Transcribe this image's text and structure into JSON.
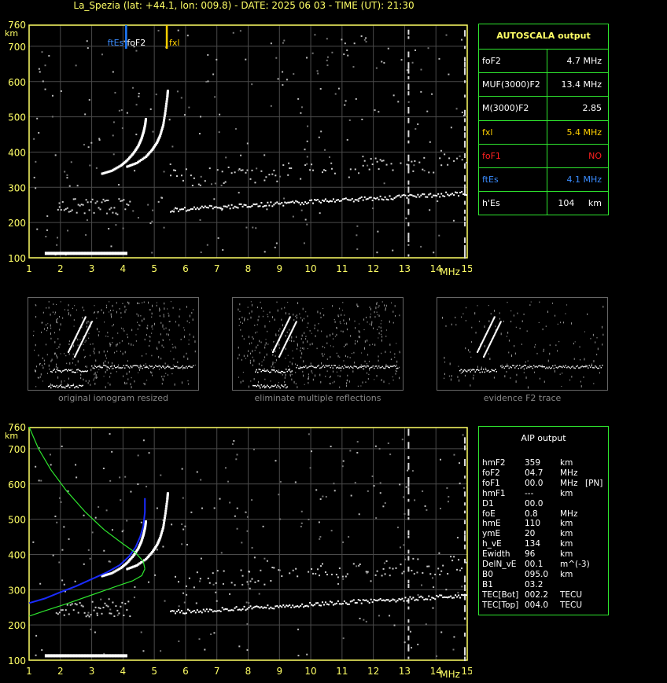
{
  "header": {
    "title": "La_Spezia (lat: +44.1, lon: 009.8) - DATE: 2025 06 03 - TIME (UT): 21:30"
  },
  "colors": {
    "axis": "#ffff66",
    "panel_border": "#2ee62e",
    "grid": "#4a4a4a",
    "foF2_marker": "#1e7bff",
    "fxl_marker": "#ffd000",
    "profile_blue": "#1a2cff",
    "profile_green": "#2ee62e",
    "red": "#ff2020",
    "blue_text": "#3a8cff",
    "yellow_text": "#ffd000"
  },
  "autoscala": {
    "title": "AUTOSCALA output",
    "rows": [
      {
        "label": "foF2",
        "value": "4.7 MHz",
        "color": "#ffffff"
      },
      {
        "label": "MUF(3000)F2",
        "value": "13.4 MHz",
        "color": "#ffffff"
      },
      {
        "label": "M(3000)F2",
        "value": "2.85",
        "color": "#ffffff"
      },
      {
        "label": "fxl",
        "value": "5.4 MHz",
        "color": "#ffd000"
      },
      {
        "label": "foF1",
        "value": "NO",
        "color": "#ff2020"
      },
      {
        "label": "ftEs",
        "value": "4.1 MHz",
        "color": "#3a8cff"
      },
      {
        "label": "h'Es",
        "value": "104",
        "unit": "km",
        "color": "#ffffff"
      }
    ]
  },
  "aip": {
    "title": "AIP output",
    "rows": [
      {
        "name": "hmF2",
        "value": "359",
        "unit": "km",
        "extra": ""
      },
      {
        "name": "foF2",
        "value": "04.7",
        "unit": "MHz",
        "extra": ""
      },
      {
        "name": "foF1",
        "value": "00.0",
        "unit": "MHz",
        "extra": "[PN]"
      },
      {
        "name": "hmF1",
        "value": "---",
        "unit": "km",
        "extra": ""
      },
      {
        "name": "D1",
        "value": "00.0",
        "unit": "",
        "extra": ""
      },
      {
        "name": "foE",
        "value": "0.8",
        "unit": "MHz",
        "extra": ""
      },
      {
        "name": "hmE",
        "value": "110",
        "unit": "km",
        "extra": ""
      },
      {
        "name": "ymE",
        "value": "20",
        "unit": "km",
        "extra": ""
      },
      {
        "name": "h_vE",
        "value": "134",
        "unit": "km",
        "extra": ""
      },
      {
        "name": "Ewidth",
        "value": "96",
        "unit": "km",
        "extra": ""
      },
      {
        "name": "DelN_vE",
        "value": "00.1",
        "unit": "m^(-3)",
        "extra": ""
      },
      {
        "name": "B0",
        "value": "095.0",
        "unit": "km",
        "extra": ""
      },
      {
        "name": "B1",
        "value": "03.2",
        "unit": "",
        "extra": ""
      },
      {
        "name": "TEC[Bot]",
        "value": "002.2",
        "unit": "TECU",
        "extra": ""
      },
      {
        "name": "TEC[Top]",
        "value": "004.0",
        "unit": "TECU",
        "extra": ""
      }
    ]
  },
  "thumbnails": [
    {
      "caption": "original ionogram resized"
    },
    {
      "caption": "eliminate multiple reflections"
    },
    {
      "caption": "evidence F2 trace"
    }
  ],
  "chart_data": [
    {
      "type": "scatter",
      "title": "",
      "xlabel": "MHz",
      "ylabel": "km",
      "xlim": [
        1,
        15
      ],
      "ylim": [
        100,
        760
      ],
      "xticks": [
        1,
        2,
        3,
        4,
        5,
        6,
        7,
        8,
        9,
        10,
        11,
        12,
        13,
        14,
        15
      ],
      "yticks": [
        100,
        200,
        300,
        400,
        500,
        600,
        700,
        760
      ],
      "grid": true,
      "markers": [
        {
          "name": "ftEs",
          "x": 4.1,
          "color": "#1e7bff"
        },
        {
          "name": "foF2",
          "x": 4.1,
          "color": "#1e7bff"
        },
        {
          "name": "fxl",
          "x": 5.4,
          "color": "#ffd000"
        }
      ],
      "traces": {
        "es_layer": {
          "x_from": 1.5,
          "x_to": 4.1,
          "height": 117
        },
        "f2_ordinary": [
          [
            3.3,
            342
          ],
          [
            3.6,
            350
          ],
          [
            3.9,
            365
          ],
          [
            4.1,
            380
          ],
          [
            4.3,
            400
          ],
          [
            4.45,
            420
          ],
          [
            4.55,
            440
          ],
          [
            4.62,
            460
          ],
          [
            4.67,
            480
          ],
          [
            4.7,
            500
          ]
        ],
        "f2_extra": [
          [
            4.1,
            362
          ],
          [
            4.4,
            372
          ],
          [
            4.7,
            390
          ],
          [
            4.9,
            410
          ],
          [
            5.05,
            430
          ],
          [
            5.15,
            450
          ],
          [
            5.25,
            480
          ],
          [
            5.32,
            520
          ],
          [
            5.38,
            560
          ],
          [
            5.4,
            580
          ]
        ],
        "es_multiple": {
          "x_from": 1.9,
          "x_to": 4.2,
          "height": 228
        },
        "f_spread": {
          "x_from": 5.5,
          "x_to": 15,
          "height": 232
        }
      }
    },
    {
      "type": "line",
      "title": "",
      "xlabel": "MHz",
      "ylabel": "km",
      "xlim": [
        1,
        15
      ],
      "ylim": [
        100,
        760
      ],
      "xticks": [
        1,
        2,
        3,
        4,
        5,
        6,
        7,
        8,
        9,
        10,
        11,
        12,
        13,
        14,
        15
      ],
      "yticks": [
        100,
        200,
        300,
        400,
        500,
        600,
        700,
        760
      ],
      "grid": true,
      "series": [
        {
          "color": "#1a2cff",
          "points": [
            [
              1.0,
              262
            ],
            [
              1.5,
              275
            ],
            [
              2.0,
              293
            ],
            [
              2.5,
              310
            ],
            [
              3.0,
              330
            ],
            [
              3.5,
              350
            ],
            [
              3.9,
              370
            ],
            [
              4.2,
              395
            ],
            [
              4.4,
              420
            ],
            [
              4.55,
              450
            ],
            [
              4.65,
              480
            ],
            [
              4.7,
              520
            ],
            [
              4.7,
              560
            ]
          ]
        },
        {
          "color": "#2ee62e",
          "points": [
            [
              1.0,
              762
            ],
            [
              1.3,
              700
            ],
            [
              1.7,
              640
            ],
            [
              2.2,
              580
            ],
            [
              2.8,
              520
            ],
            [
              3.4,
              470
            ],
            [
              4.0,
              430
            ],
            [
              4.4,
              405
            ],
            [
              4.65,
              380
            ],
            [
              4.7,
              359
            ]
          ]
        },
        {
          "color": "#2ee62e",
          "points": [
            [
              4.7,
              359
            ],
            [
              4.6,
              340
            ],
            [
              4.3,
              325
            ],
            [
              3.8,
              310
            ],
            [
              3.0,
              285
            ],
            [
              2.2,
              260
            ],
            [
              1.5,
              240
            ],
            [
              1.0,
              225
            ]
          ]
        }
      ]
    }
  ]
}
